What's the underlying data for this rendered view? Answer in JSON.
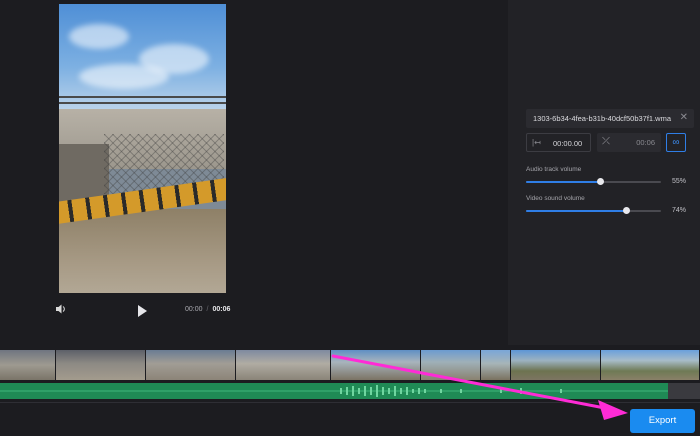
{
  "player": {
    "current_time": "00:00",
    "separator": "/",
    "total_time": "00:06",
    "icons": {
      "volume": "speaker-icon",
      "play": "play-icon"
    }
  },
  "panel": {
    "file_name": "1303-6b34-4fea-b31b-40dcf50b37f1.wma",
    "start_time": "00:00.00",
    "end_time": "00:06",
    "audio_volume_label": "Audio track volume",
    "audio_volume_value": "55%",
    "audio_volume_level": 0.55,
    "video_volume_label": "Video sound volume",
    "video_volume_value": "74%",
    "video_volume_level": 0.74,
    "icons": {
      "close": "close-icon",
      "start": "trim-start-icon",
      "end": "trim-end-icon",
      "loop": "loop-icon"
    }
  },
  "timeline": {
    "frame_count": 9
  },
  "export": {
    "label": "Export"
  },
  "colors": {
    "accent": "#1a8bf0",
    "audio_track": "#1f8a55",
    "annotation_arrow": "#ff2bd6"
  }
}
